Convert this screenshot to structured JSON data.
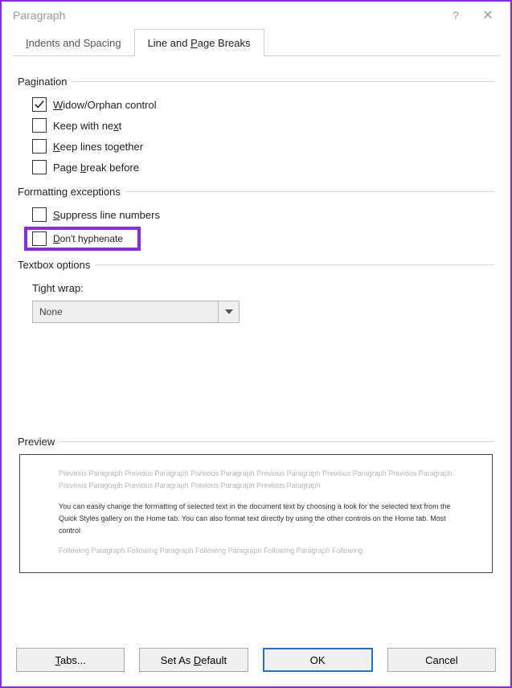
{
  "window": {
    "title": "Paragraph"
  },
  "tabs": {
    "indents": {
      "pre": "",
      "u": "I",
      "post": "ndents and Spacing"
    },
    "line": {
      "pre": "Line and ",
      "u": "P",
      "post": "age Breaks"
    }
  },
  "groups": {
    "pagination": "Pagination",
    "formatting": "Formatting exceptions",
    "textbox": "Textbox options",
    "preview": "Preview"
  },
  "checks": {
    "widow": {
      "pre": "",
      "u": "W",
      "post": "idow/Orphan control",
      "checked": true
    },
    "keepnext": {
      "pre": "Keep with ne",
      "u": "x",
      "post": "t",
      "checked": false
    },
    "keeplines": {
      "pre": "",
      "u": "K",
      "post": "eep lines together",
      "checked": false
    },
    "pagebreak": {
      "pre": "Page ",
      "u": "b",
      "post": "reak before",
      "checked": false
    },
    "suppress": {
      "pre": "",
      "u": "S",
      "post": "uppress line numbers",
      "checked": false
    },
    "hyphen": {
      "pre": "",
      "u": "D",
      "post": "on't hyphenate",
      "checked": false
    }
  },
  "tightwrap": {
    "label": "Tight wrap:",
    "value": "None"
  },
  "preview": {
    "ghost_top": "Previous Paragraph Previous Paragraph Previous Paragraph Previous Paragraph Previous Paragraph Previous Paragraph Previous Paragraph Previous Paragraph Previous Paragraph Previous Paragraph",
    "sample": "You can easily change the formatting of selected text in the document text by choosing a look for the selected text from the Quick Styles gallery on the Home tab. You can also format text directly by using the other controls on the Home tab. Most control",
    "ghost_bottom": "Following Paragraph Following Paragraph Following Paragraph Following Paragraph Following"
  },
  "buttons": {
    "tabs": {
      "pre": "",
      "u": "T",
      "post": "abs..."
    },
    "default": {
      "pre": "Set As ",
      "u": "D",
      "post": "efault"
    },
    "ok": "OK",
    "cancel": "Cancel"
  }
}
